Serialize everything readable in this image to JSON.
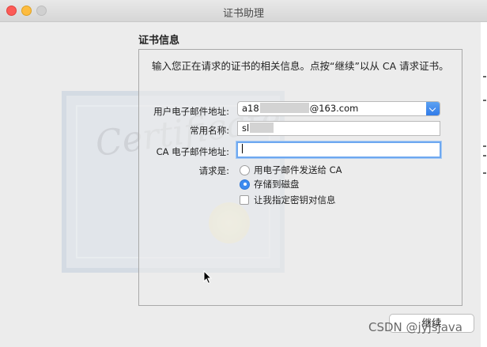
{
  "window": {
    "title": "证书助理"
  },
  "section": {
    "title": "证书信息"
  },
  "intro": "输入您正在请求的证书的相关信息。点按“继续”以从 CA 请求证书。",
  "form": {
    "email": {
      "label": "用户电子邮件地址:",
      "value_prefix": "a18",
      "value_suffix": "@163.com"
    },
    "common_name": {
      "label": "常用名称:",
      "value_prefix": "sl"
    },
    "ca_email": {
      "label": "CA 电子邮件地址:",
      "value": ""
    },
    "request": {
      "label": "请求是:",
      "options": [
        {
          "label": "用电子邮件发送给 CA",
          "selected": false
        },
        {
          "label": "存储到磁盘",
          "selected": true
        }
      ],
      "checkbox": {
        "label": "让我指定密钥对信息",
        "checked": false
      }
    }
  },
  "buttons": {
    "continue": "继续"
  },
  "watermark": "CSDN @jyjsjava",
  "colors": {
    "accent": "#3d8bf0",
    "close": "#fc5b57",
    "minimize": "#fdbc40"
  }
}
